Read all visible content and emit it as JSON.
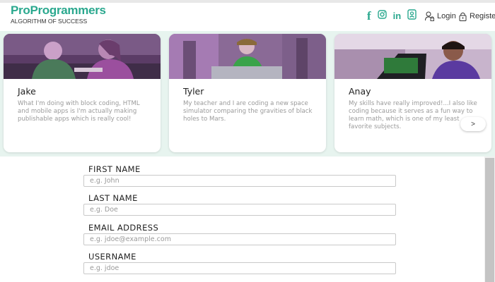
{
  "header": {
    "logo_title": "ProProgrammers",
    "logo_subtitle": "ALGORITHM OF SUCCESS",
    "social_icons": [
      "facebook-icon",
      "instagram-icon",
      "linkedin-icon",
      "app-icon"
    ],
    "login_label": "Login",
    "register_label": "Register"
  },
  "testimonials": [
    {
      "name": "Jake",
      "quote": "What I'm doing with block coding, HTML and mobile apps is I'm actually making publishable apps which is really cool!"
    },
    {
      "name": "Tyler",
      "quote": "My teacher and I are coding a new space simulator comparing the gravities of black holes to Mars."
    },
    {
      "name": "Anay",
      "quote": "My skills have really improved!...I also like coding because it serves as a fun way to learn math, which is one of my least favorite subjects."
    }
  ],
  "carousel": {
    "next_label": ">"
  },
  "form": {
    "first_name": {
      "label": "FIRST NAME",
      "placeholder": "e.g. John"
    },
    "last_name": {
      "label": "LAST NAME",
      "placeholder": "e.g. Doe"
    },
    "email": {
      "label": "EMAIL ADDRESS",
      "placeholder": "e.g. jdoe@example.com"
    },
    "username": {
      "label": "USERNAME",
      "placeholder": "e.g. jdoe"
    }
  },
  "colors": {
    "brand": "#2aa88e",
    "carousel_bg": "#e7f4ef",
    "photo_tint": "#8e5aa0"
  }
}
